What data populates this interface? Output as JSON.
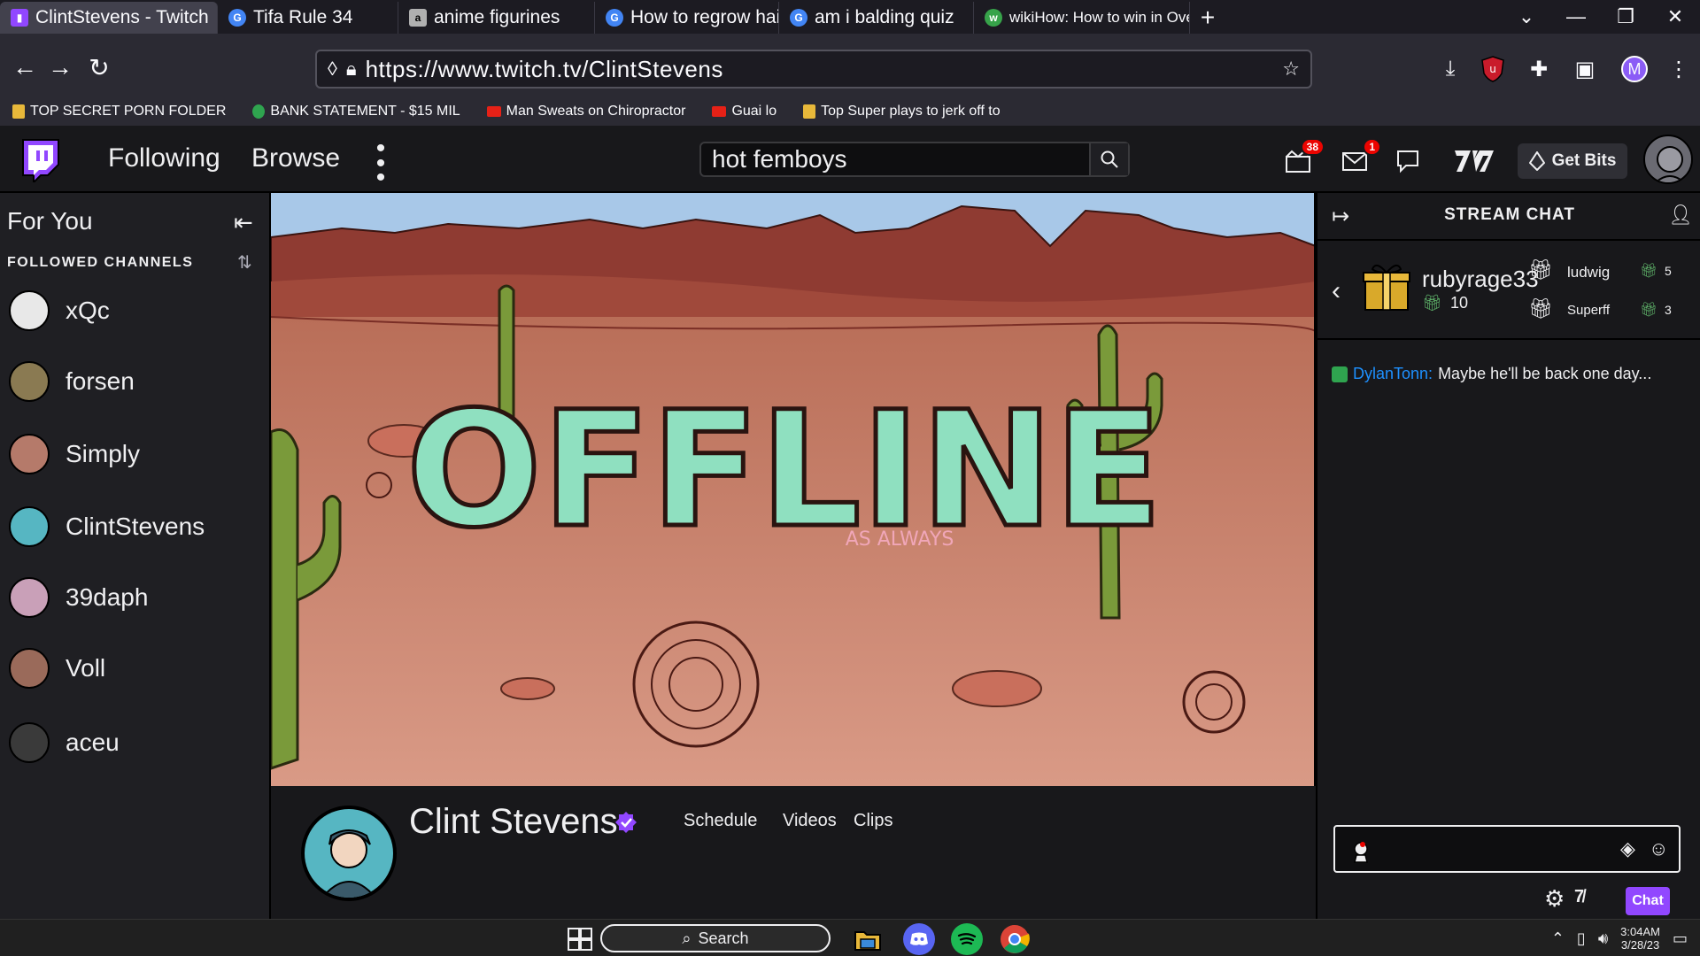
{
  "browser": {
    "tabs": [
      {
        "label": "ClintStevens - Twitch",
        "active": true,
        "favicon_color": "#9147ff"
      },
      {
        "label": "Tifa Rule 34",
        "active": false,
        "favicon_color": "#4285f4"
      },
      {
        "label": "anime figurines",
        "active": false,
        "favicon_color": "#b0b0b0"
      },
      {
        "label": "How to regrow hair",
        "active": false,
        "favicon_color": "#4285f4"
      },
      {
        "label": "am i balding quiz",
        "active": false,
        "favicon_color": "#4285f4"
      },
      {
        "label": "wikiHow: How to win in Ove..",
        "active": false,
        "favicon_color": "#37a34a"
      }
    ],
    "url": "https://www.twitch.tv/ClintStevens",
    "bookmarks": [
      {
        "label": "TOP SECRET PORN FOLDER",
        "icon": "folder-icon",
        "color": "#e8b83a"
      },
      {
        "label": "BANK STATEMENT - $15 MIL",
        "icon": "money-icon",
        "color": "#2fa44f"
      },
      {
        "label": "Man Sweats on Chiropractor",
        "icon": "youtube-icon",
        "color": "#e62117"
      },
      {
        "label": "Guai lo",
        "icon": "youtube-icon",
        "color": "#e62117"
      },
      {
        "label": "Top Super plays to jerk off to",
        "icon": "folder-icon",
        "color": "#e8b83a"
      }
    ],
    "profile_initial": "M"
  },
  "twitch": {
    "nav": {
      "following": "Following",
      "browse": "Browse",
      "search_query": "hot femboys",
      "notif_count": "38",
      "inbox_count": "1",
      "get_bits": "Get Bits"
    },
    "sidebar": {
      "title": "For You",
      "section": "FOLLOWED CHANNELS",
      "channels": [
        {
          "name": "xQc",
          "color": "#e8e8e8"
        },
        {
          "name": "forsen",
          "color": "#8a7a52"
        },
        {
          "name": "Simply",
          "color": "#b57a6a"
        },
        {
          "name": "ClintStevens",
          "color": "#56b6c2"
        },
        {
          "name": "39daph",
          "color": "#c9a0b8"
        },
        {
          "name": "Voll",
          "color": "#9a6a5a"
        },
        {
          "name": "aceu",
          "color": "#3a3a3a"
        }
      ]
    },
    "player": {
      "status": "OFFLINE",
      "subtitle": "AS ALWAYS"
    },
    "channel": {
      "name": "Clint Stevens",
      "tabs": [
        "Schedule",
        "Videos",
        "Clips"
      ]
    },
    "chat": {
      "title": "STREAM CHAT",
      "top_gifter": {
        "name": "rubyrage33",
        "count": "10"
      },
      "gifters": [
        {
          "name": "ludwig",
          "count": "5"
        },
        {
          "name": "Superff",
          "count": "3"
        }
      ],
      "message": {
        "user": "DylanTonn:",
        "text": "Maybe he'll be back one day..."
      },
      "send_label": "Chat"
    }
  },
  "taskbar": {
    "search": "Search",
    "time": "3:04AM",
    "date": "3/28/23"
  }
}
